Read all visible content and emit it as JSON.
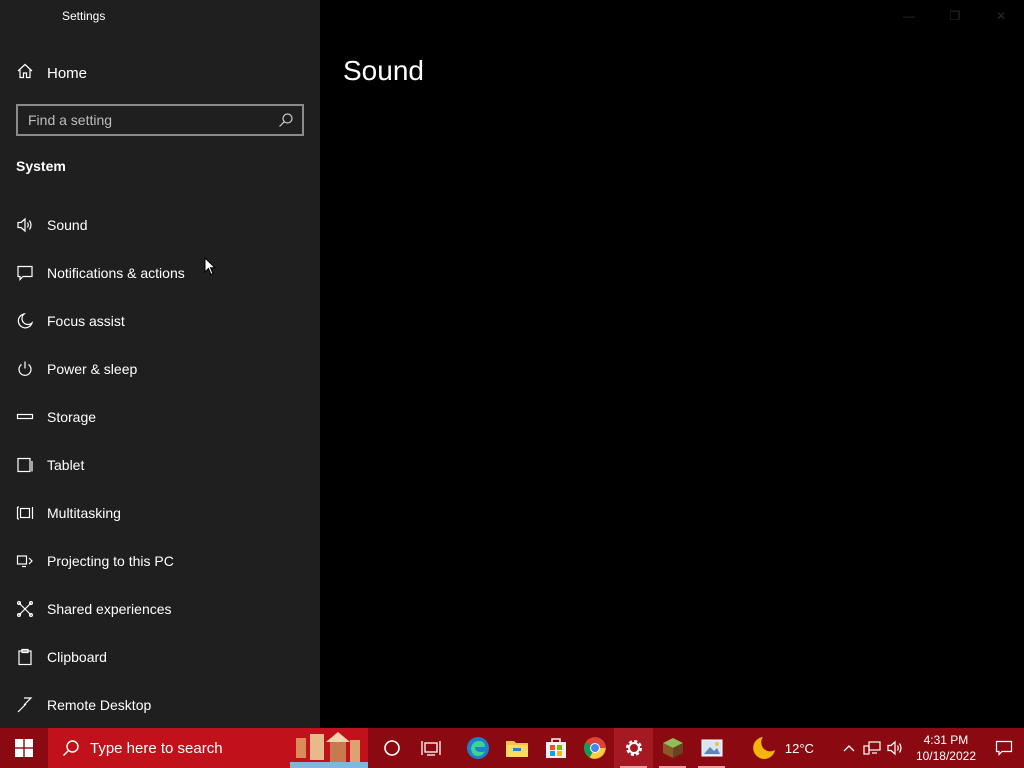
{
  "window": {
    "title": "Settings",
    "controls": [
      "minimize",
      "restore",
      "close"
    ]
  },
  "sidebar": {
    "home_label": "Home",
    "search_placeholder": "Find a setting",
    "section_title": "System",
    "items": [
      {
        "label": "Sound",
        "icon": "speaker-icon"
      },
      {
        "label": "Notifications & actions",
        "icon": "notification-icon"
      },
      {
        "label": "Focus assist",
        "icon": "moon-icon"
      },
      {
        "label": "Power & sleep",
        "icon": "power-icon"
      },
      {
        "label": "Storage",
        "icon": "storage-icon"
      },
      {
        "label": "Tablet",
        "icon": "tablet-icon"
      },
      {
        "label": "Multitasking",
        "icon": "multitasking-icon"
      },
      {
        "label": "Projecting to this PC",
        "icon": "projecting-icon"
      },
      {
        "label": "Shared experiences",
        "icon": "shared-experiences-icon"
      },
      {
        "label": "Clipboard",
        "icon": "clipboard-icon"
      },
      {
        "label": "Remote Desktop",
        "icon": "remote-desktop-icon"
      }
    ]
  },
  "main": {
    "page_title": "Sound"
  },
  "taskbar": {
    "search_placeholder": "Type here to search",
    "apps": [
      "cortana-icon",
      "task-view-icon",
      "edge-icon",
      "file-explorer-icon",
      "store-icon",
      "chrome-icon",
      "settings-icon",
      "minecraft-icon",
      "photos-icon"
    ],
    "weather_temp": "12°C",
    "time": "4:31 PM",
    "date": "10/18/2022",
    "colors": {
      "taskbar": "#8b0a12",
      "search_box": "#c1121c"
    }
  }
}
